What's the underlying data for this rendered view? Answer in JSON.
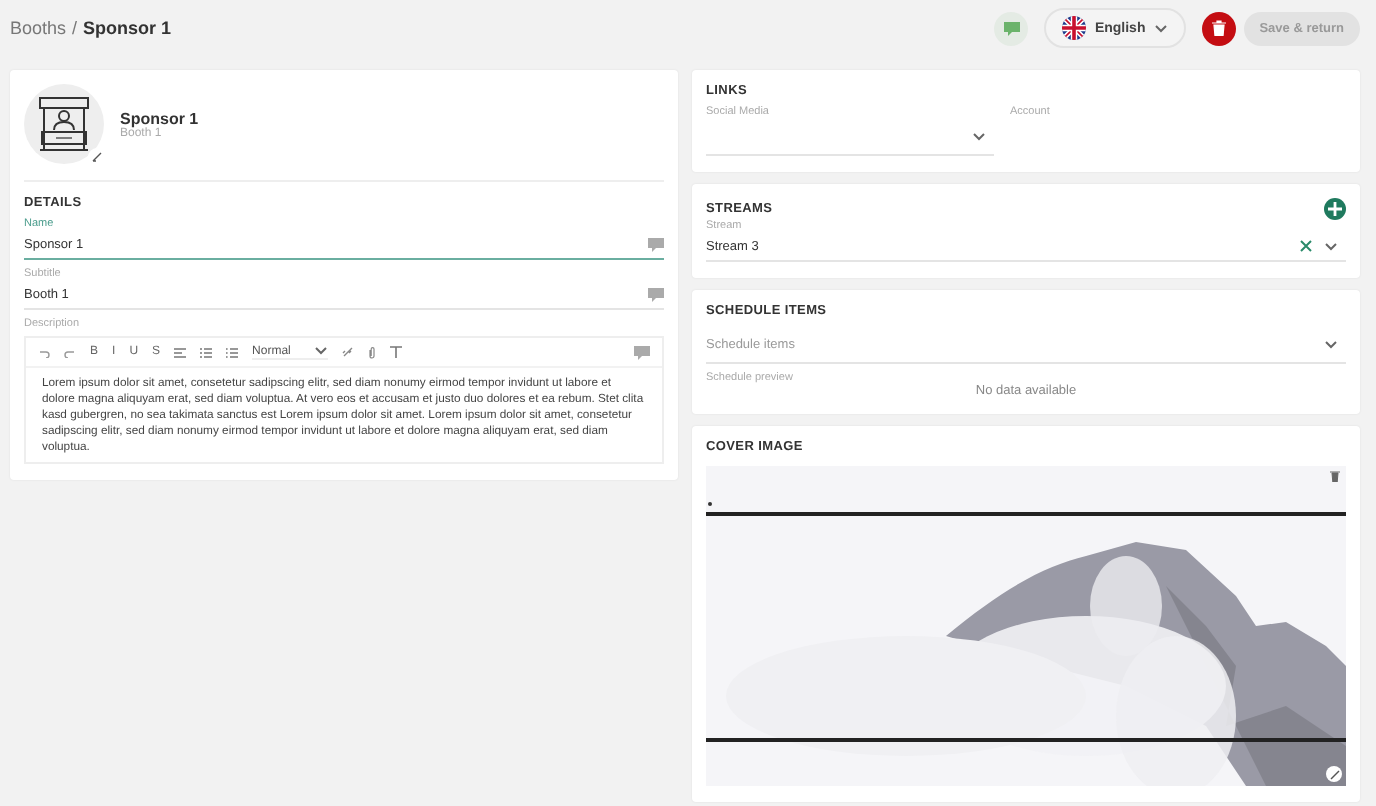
{
  "breadcrumb": {
    "parent": "Booths",
    "separator": "/",
    "current": "Sponsor 1"
  },
  "header": {
    "language": "English",
    "save_button": {
      "label": "Save & return",
      "disabled": true
    }
  },
  "profile": {
    "title": "Sponsor 1",
    "subtitle": "Booth 1"
  },
  "details": {
    "heading": "DETAILS",
    "fields": [
      {
        "label": "Name",
        "value": "Sponsor 1",
        "focused": true
      },
      {
        "label": "Subtitle",
        "value": "Booth 1",
        "focused": false
      }
    ],
    "description": {
      "label": "Description",
      "toolbar": [
        {
          "kind": "undo"
        },
        {
          "kind": "redo"
        },
        {
          "kind": "text",
          "label": "B"
        },
        {
          "kind": "text",
          "label": "I"
        },
        {
          "kind": "text",
          "label": "U"
        },
        {
          "kind": "text",
          "label": "S"
        },
        {
          "kind": "align"
        },
        {
          "kind": "olist"
        },
        {
          "kind": "ulist"
        },
        {
          "kind": "select",
          "value": "Normal"
        },
        {
          "kind": "link"
        },
        {
          "kind": "attach"
        },
        {
          "kind": "clear"
        }
      ],
      "text": "Lorem ipsum dolor sit amet, consetetur sadipscing elitr, sed diam nonumy eirmod tempor invidunt ut labore et dolore magna aliquyam erat, sed diam voluptua. At vero eos et accusam et justo duo dolores et ea rebum. Stet clita kasd gubergren, no sea takimata sanctus est Lorem ipsum dolor sit amet. Lorem ipsum dolor sit amet, consetetur sadipscing elitr, sed diam nonumy eirmod tempor invidunt ut labore et dolore magna aliquyam erat, sed diam voluptua."
    }
  },
  "links": {
    "heading": "LINKS",
    "social_media_label": "Social Media",
    "account_label": "Account"
  },
  "streams": {
    "heading": "STREAMS",
    "label": "Stream",
    "value": "Stream 3"
  },
  "schedule": {
    "heading": "SCHEDULE ITEMS",
    "placeholder": "Schedule items",
    "preview_label": "Schedule preview",
    "empty_text": "No data available"
  },
  "cover": {
    "heading": "COVER IMAGE"
  }
}
